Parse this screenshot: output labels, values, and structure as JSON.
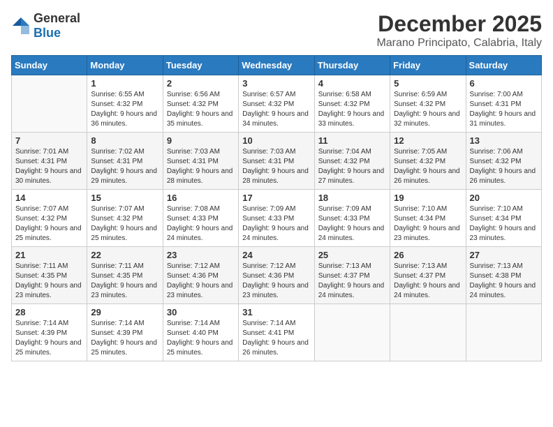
{
  "logo": {
    "general": "General",
    "blue": "Blue"
  },
  "header": {
    "month": "December 2025",
    "location": "Marano Principato, Calabria, Italy"
  },
  "weekdays": [
    "Sunday",
    "Monday",
    "Tuesday",
    "Wednesday",
    "Thursday",
    "Friday",
    "Saturday"
  ],
  "weeks": [
    [
      {
        "day": "",
        "sunrise": "",
        "sunset": "",
        "daylight": ""
      },
      {
        "day": "1",
        "sunrise": "Sunrise: 6:55 AM",
        "sunset": "Sunset: 4:32 PM",
        "daylight": "Daylight: 9 hours and 36 minutes."
      },
      {
        "day": "2",
        "sunrise": "Sunrise: 6:56 AM",
        "sunset": "Sunset: 4:32 PM",
        "daylight": "Daylight: 9 hours and 35 minutes."
      },
      {
        "day": "3",
        "sunrise": "Sunrise: 6:57 AM",
        "sunset": "Sunset: 4:32 PM",
        "daylight": "Daylight: 9 hours and 34 minutes."
      },
      {
        "day": "4",
        "sunrise": "Sunrise: 6:58 AM",
        "sunset": "Sunset: 4:32 PM",
        "daylight": "Daylight: 9 hours and 33 minutes."
      },
      {
        "day": "5",
        "sunrise": "Sunrise: 6:59 AM",
        "sunset": "Sunset: 4:32 PM",
        "daylight": "Daylight: 9 hours and 32 minutes."
      },
      {
        "day": "6",
        "sunrise": "Sunrise: 7:00 AM",
        "sunset": "Sunset: 4:31 PM",
        "daylight": "Daylight: 9 hours and 31 minutes."
      }
    ],
    [
      {
        "day": "7",
        "sunrise": "Sunrise: 7:01 AM",
        "sunset": "Sunset: 4:31 PM",
        "daylight": "Daylight: 9 hours and 30 minutes."
      },
      {
        "day": "8",
        "sunrise": "Sunrise: 7:02 AM",
        "sunset": "Sunset: 4:31 PM",
        "daylight": "Daylight: 9 hours and 29 minutes."
      },
      {
        "day": "9",
        "sunrise": "Sunrise: 7:03 AM",
        "sunset": "Sunset: 4:31 PM",
        "daylight": "Daylight: 9 hours and 28 minutes."
      },
      {
        "day": "10",
        "sunrise": "Sunrise: 7:03 AM",
        "sunset": "Sunset: 4:31 PM",
        "daylight": "Daylight: 9 hours and 28 minutes."
      },
      {
        "day": "11",
        "sunrise": "Sunrise: 7:04 AM",
        "sunset": "Sunset: 4:32 PM",
        "daylight": "Daylight: 9 hours and 27 minutes."
      },
      {
        "day": "12",
        "sunrise": "Sunrise: 7:05 AM",
        "sunset": "Sunset: 4:32 PM",
        "daylight": "Daylight: 9 hours and 26 minutes."
      },
      {
        "day": "13",
        "sunrise": "Sunrise: 7:06 AM",
        "sunset": "Sunset: 4:32 PM",
        "daylight": "Daylight: 9 hours and 26 minutes."
      }
    ],
    [
      {
        "day": "14",
        "sunrise": "Sunrise: 7:07 AM",
        "sunset": "Sunset: 4:32 PM",
        "daylight": "Daylight: 9 hours and 25 minutes."
      },
      {
        "day": "15",
        "sunrise": "Sunrise: 7:07 AM",
        "sunset": "Sunset: 4:32 PM",
        "daylight": "Daylight: 9 hours and 25 minutes."
      },
      {
        "day": "16",
        "sunrise": "Sunrise: 7:08 AM",
        "sunset": "Sunset: 4:33 PM",
        "daylight": "Daylight: 9 hours and 24 minutes."
      },
      {
        "day": "17",
        "sunrise": "Sunrise: 7:09 AM",
        "sunset": "Sunset: 4:33 PM",
        "daylight": "Daylight: 9 hours and 24 minutes."
      },
      {
        "day": "18",
        "sunrise": "Sunrise: 7:09 AM",
        "sunset": "Sunset: 4:33 PM",
        "daylight": "Daylight: 9 hours and 24 minutes."
      },
      {
        "day": "19",
        "sunrise": "Sunrise: 7:10 AM",
        "sunset": "Sunset: 4:34 PM",
        "daylight": "Daylight: 9 hours and 23 minutes."
      },
      {
        "day": "20",
        "sunrise": "Sunrise: 7:10 AM",
        "sunset": "Sunset: 4:34 PM",
        "daylight": "Daylight: 9 hours and 23 minutes."
      }
    ],
    [
      {
        "day": "21",
        "sunrise": "Sunrise: 7:11 AM",
        "sunset": "Sunset: 4:35 PM",
        "daylight": "Daylight: 9 hours and 23 minutes."
      },
      {
        "day": "22",
        "sunrise": "Sunrise: 7:11 AM",
        "sunset": "Sunset: 4:35 PM",
        "daylight": "Daylight: 9 hours and 23 minutes."
      },
      {
        "day": "23",
        "sunrise": "Sunrise: 7:12 AM",
        "sunset": "Sunset: 4:36 PM",
        "daylight": "Daylight: 9 hours and 23 minutes."
      },
      {
        "day": "24",
        "sunrise": "Sunrise: 7:12 AM",
        "sunset": "Sunset: 4:36 PM",
        "daylight": "Daylight: 9 hours and 23 minutes."
      },
      {
        "day": "25",
        "sunrise": "Sunrise: 7:13 AM",
        "sunset": "Sunset: 4:37 PM",
        "daylight": "Daylight: 9 hours and 24 minutes."
      },
      {
        "day": "26",
        "sunrise": "Sunrise: 7:13 AM",
        "sunset": "Sunset: 4:37 PM",
        "daylight": "Daylight: 9 hours and 24 minutes."
      },
      {
        "day": "27",
        "sunrise": "Sunrise: 7:13 AM",
        "sunset": "Sunset: 4:38 PM",
        "daylight": "Daylight: 9 hours and 24 minutes."
      }
    ],
    [
      {
        "day": "28",
        "sunrise": "Sunrise: 7:14 AM",
        "sunset": "Sunset: 4:39 PM",
        "daylight": "Daylight: 9 hours and 25 minutes."
      },
      {
        "day": "29",
        "sunrise": "Sunrise: 7:14 AM",
        "sunset": "Sunset: 4:39 PM",
        "daylight": "Daylight: 9 hours and 25 minutes."
      },
      {
        "day": "30",
        "sunrise": "Sunrise: 7:14 AM",
        "sunset": "Sunset: 4:40 PM",
        "daylight": "Daylight: 9 hours and 25 minutes."
      },
      {
        "day": "31",
        "sunrise": "Sunrise: 7:14 AM",
        "sunset": "Sunset: 4:41 PM",
        "daylight": "Daylight: 9 hours and 26 minutes."
      },
      {
        "day": "",
        "sunrise": "",
        "sunset": "",
        "daylight": ""
      },
      {
        "day": "",
        "sunrise": "",
        "sunset": "",
        "daylight": ""
      },
      {
        "day": "",
        "sunrise": "",
        "sunset": "",
        "daylight": ""
      }
    ]
  ]
}
